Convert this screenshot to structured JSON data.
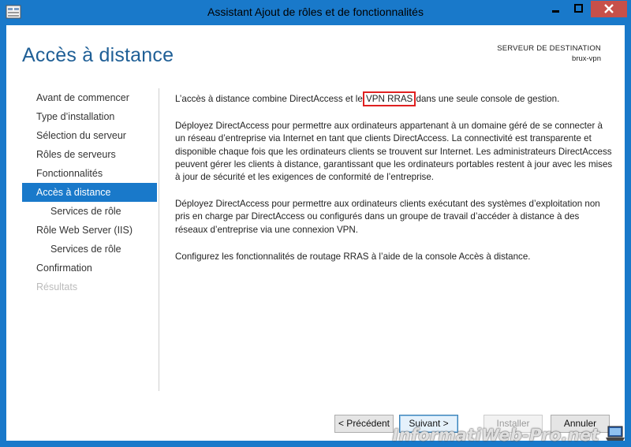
{
  "window": {
    "title": "Assistant Ajout de rôles et de fonctionnalités",
    "accent": "#1979ca"
  },
  "header": {
    "page_title": "Accès à distance",
    "destination_label": "SERVEUR DE DESTINATION",
    "destination_value": "brux-vpn"
  },
  "nav": {
    "items": [
      {
        "label": "Avant de commencer",
        "state": "normal"
      },
      {
        "label": "Type d’installation",
        "state": "normal"
      },
      {
        "label": "Sélection du serveur",
        "state": "normal"
      },
      {
        "label": "Rôles de serveurs",
        "state": "normal"
      },
      {
        "label": "Fonctionnalités",
        "state": "normal"
      },
      {
        "label": "Accès à distance",
        "state": "active"
      },
      {
        "label": "Services de rôle",
        "state": "sub"
      },
      {
        "label": "Rôle Web Server (IIS)",
        "state": "normal"
      },
      {
        "label": "Services de rôle",
        "state": "sub"
      },
      {
        "label": "Confirmation",
        "state": "normal"
      },
      {
        "label": "Résultats",
        "state": "disabled"
      }
    ]
  },
  "content": {
    "p1_before": "L’accès à distance combine DirectAccess et le ",
    "p1_highlight": "VPN RRAS",
    "p1_after": " dans une seule console de gestion.",
    "p2": "Déployez DirectAccess pour permettre aux ordinateurs appartenant à un domaine géré de se connecter à un réseau d’entreprise via Internet en tant que clients DirectAccess. La connectivité est transparente et disponible chaque fois que les ordinateurs clients se trouvent sur Internet. Les administrateurs DirectAccess peuvent gérer les clients à distance, garantissant que les ordinateurs portables restent à jour avec les mises à jour de sécurité et les exigences de conformité de l’entreprise.",
    "p3": "Déployez DirectAccess pour permettre aux ordinateurs clients exécutant des systèmes d’exploitation non pris en charge par DirectAccess ou configurés dans un groupe de travail d’accéder à distance à des réseaux d’entreprise via une connexion VPN.",
    "p4": "Configurez les fonctionnalités de routage RRAS à l’aide de la console Accès à distance."
  },
  "buttons": {
    "previous": "< Précédent",
    "next": "Suivant >",
    "install": "Installer",
    "cancel": "Annuler"
  },
  "watermark": {
    "text": "InformatiWeb-Pro.net"
  }
}
